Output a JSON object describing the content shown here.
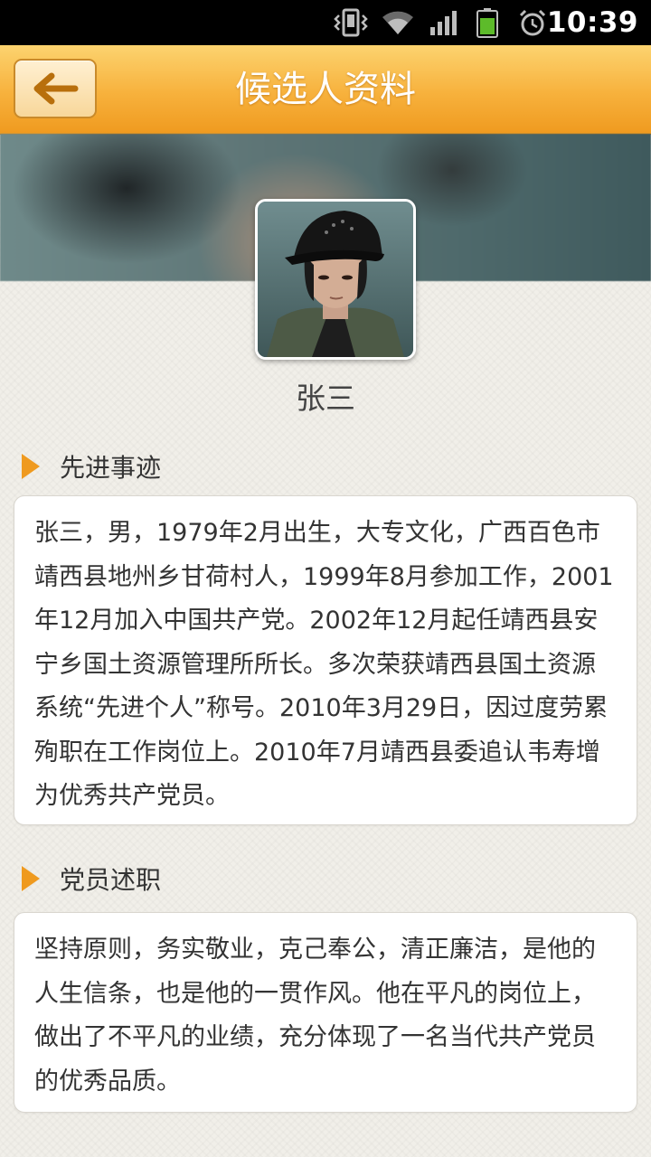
{
  "status_bar": {
    "time": "10:39",
    "icons": [
      "vibrate-icon",
      "wifi-icon",
      "signal-icon",
      "battery-icon",
      "alarm-icon"
    ]
  },
  "header": {
    "title": "候选人资料",
    "back_icon": "back-arrow-icon"
  },
  "profile": {
    "name": "张三"
  },
  "sections": [
    {
      "title": "先进事迹",
      "text": "张三，男，1979年2月出生，大专文化，广西百色市靖西县地州乡甘荷村人，1999年8月参加工作，2001年12月加入中国共产党。2002年12月起任靖西县安宁乡国土资源管理所所长。多次荣获靖西县国土资源系统“先进个人”称号。2010年3月29日，因过度劳累殉职在工作岗位上。2010年7月靖西县委追认韦寿增为优秀共产党员。"
    },
    {
      "title": "党员述职",
      "text": "坚持原则，务实敬业，克己奉公，清正廉洁，是他的人生信条，也是他的一贯作风。他在平凡的岗位上，做出了不平凡的业绩，充分体现了一名当代共产党员的优秀品质。"
    }
  ],
  "colors": {
    "accent": "#ef9a1f",
    "header_top": "#fcd36f",
    "header_bottom": "#ef9a1f",
    "back_arrow": "#b86f0c"
  }
}
